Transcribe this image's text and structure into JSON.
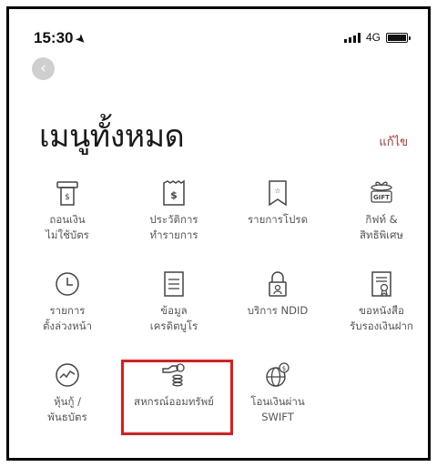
{
  "status_bar": {
    "time": "15:30",
    "network": "4G"
  },
  "header": {
    "title": "เมนูทั้งหมด",
    "edit_label": "แก้ไข"
  },
  "menu": [
    {
      "line1": "ถอนเงิน",
      "line2": "ไม่ใช้บัตร",
      "icon": "atm-cardless-icon"
    },
    {
      "line1": "ประวัติการ",
      "line2": "ทำรายการ",
      "icon": "transaction-history-icon"
    },
    {
      "line1": "รายการโปรด",
      "line2": "",
      "icon": "favorites-icon"
    },
    {
      "line1": "กิฟท์ &",
      "line2": "สิทธิพิเศษ",
      "icon": "gift-icon"
    },
    {
      "line1": "รายการ",
      "line2": "ตั้งล่วงหน้า",
      "icon": "scheduled-clock-icon"
    },
    {
      "line1": "ข้อมูล",
      "line2": "เครดิตบูโร",
      "icon": "credit-bureau-document-icon"
    },
    {
      "line1": "บริการ NDID",
      "line2": "",
      "icon": "ndid-identity-icon"
    },
    {
      "line1": "ขอหนังสือ",
      "line2": "รับรองเงินฝาก",
      "icon": "deposit-certificate-icon"
    },
    {
      "line1": "หุ้นกู้ /",
      "line2": "พันธบัตร",
      "icon": "bonds-chart-icon"
    },
    {
      "line1": "สหกรณ์ออมทรัพย์",
      "line2": "",
      "icon": "savings-cooperative-icon"
    },
    {
      "line1": "โอนเงินผ่าน",
      "line2": "SWIFT",
      "icon": "swift-globe-transfer-icon"
    }
  ]
}
